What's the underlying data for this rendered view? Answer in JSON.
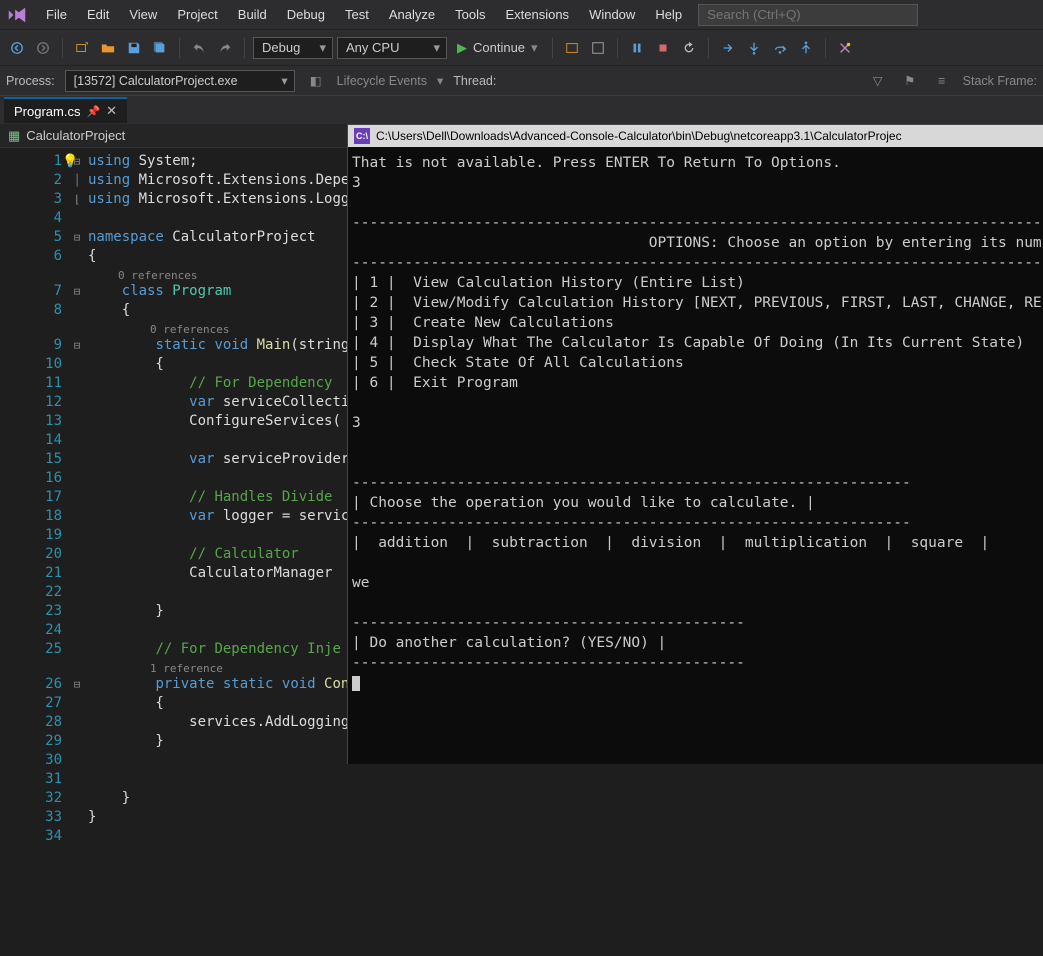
{
  "menu": {
    "items": [
      "File",
      "Edit",
      "View",
      "Project",
      "Build",
      "Debug",
      "Test",
      "Analyze",
      "Tools",
      "Extensions",
      "Window",
      "Help"
    ],
    "search_placeholder": "Search (Ctrl+Q)"
  },
  "toolbar": {
    "config_dropdown": "Debug",
    "platform_dropdown": "Any CPU",
    "continue_label": "Continue"
  },
  "toolbar2": {
    "process_label": "Process:",
    "process_value": "[13572] CalculatorProject.exe",
    "lifecycle_label": "Lifecycle Events",
    "thread_label": "Thread:",
    "stackframe_label": "Stack Frame:"
  },
  "tab": {
    "filename": "Program.cs"
  },
  "crumb": {
    "project": "CalculatorProject"
  },
  "editor": {
    "line_count": 34,
    "refs": {
      "class": "0 references",
      "main": "0 references",
      "configure": "1 reference"
    },
    "lines": {
      "l1": {
        "pre": "",
        "kw": "using",
        "rest": " System;"
      },
      "l2": {
        "pre": "",
        "kw": "using",
        "rest": " Microsoft.Extensions.Depe"
      },
      "l3": {
        "pre": "",
        "kw": "using",
        "rest": " Microsoft.Extensions.Logg"
      },
      "l4": {
        "text": ""
      },
      "l5": {
        "kw": "namespace",
        "rest": " CalculatorProject"
      },
      "l6": {
        "text": "{"
      },
      "l7": {
        "pre": "    ",
        "kw": "class",
        "id": " Program"
      },
      "l8": {
        "text": "    {"
      },
      "l9": {
        "pre": "        ",
        "kw1": "static ",
        "kw2": "void ",
        "id": "Main",
        "sig": "(string"
      },
      "l10": {
        "text": "        {"
      },
      "l11": {
        "pre": "            ",
        "cm": "// For Dependency "
      },
      "l12": {
        "pre": "            ",
        "kw": "var ",
        "id": "serviceCollecti"
      },
      "l13": {
        "pre": "            ",
        "id": "ConfigureServices("
      },
      "l14": {
        "text": ""
      },
      "l15": {
        "pre": "            ",
        "kw": "var ",
        "id": "serviceProvider"
      },
      "l16": {
        "text": ""
      },
      "l17": {
        "pre": "            ",
        "cm": "// Handles Divide "
      },
      "l18": {
        "pre": "            ",
        "kw": "var ",
        "id": "logger = servic"
      },
      "l19": {
        "text": ""
      },
      "l20": {
        "pre": "            ",
        "cm": "// Calculator"
      },
      "l21": {
        "pre": "            ",
        "id": "CalculatorManager "
      },
      "l22": {
        "text": ""
      },
      "l23": {
        "text": "        }"
      },
      "l24": {
        "text": ""
      },
      "l25": {
        "pre": "        ",
        "cm": "// For Dependency Inje"
      },
      "l26": {
        "pre": "        ",
        "kw1": "private ",
        "kw2": "static ",
        "kw3": "void ",
        "id": "Con"
      },
      "l27": {
        "text": "        {"
      },
      "l28": {
        "pre": "            ",
        "id": "services.AddLogging"
      },
      "l29": {
        "text": "        }"
      },
      "l30": {
        "text": ""
      },
      "l31": {
        "text": ""
      },
      "l32": {
        "text": "    }"
      },
      "l33": {
        "text": "}"
      },
      "l34": {
        "text": ""
      }
    }
  },
  "console": {
    "title_path": "C:\\Users\\Dell\\Downloads\\Advanced-Console-Calculator\\bin\\Debug\\netcoreapp3.1\\CalculatorProjec",
    "body": "That is not available. Press ENTER To Return To Options.\n3\n\n-------------------------------------------------------------------------------------------------\n                                  OPTIONS: Choose an option by entering its number\n-------------------------------------------------------------------------------------------------\n| 1 |  View Calculation History (Entire List)\n| 2 |  View/Modify Calculation History [NEXT, PREVIOUS, FIRST, LAST, CHANGE, RE\n| 3 |  Create New Calculations\n| 4 |  Display What The Calculator Is Capable Of Doing (In Its Current State)\n| 5 |  Check State Of All Calculations\n| 6 |  Exit Program\n\n3\n\n\n----------------------------------------------------------------\n| Choose the operation you would like to calculate. |\n----------------------------------------------------------------\n|  addition  |  subtraction  |  division  |  multiplication  |  square  |\n\nwe\n\n---------------------------------------------\n| Do another calculation? (YES/NO) |\n---------------------------------------------"
  }
}
